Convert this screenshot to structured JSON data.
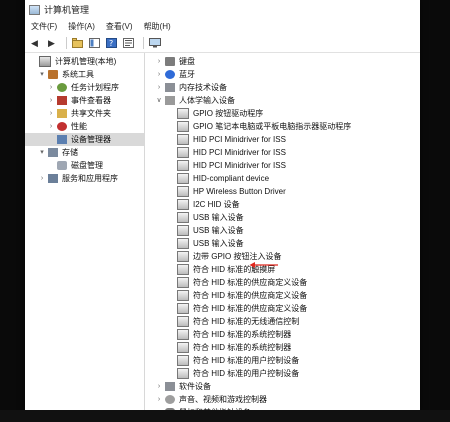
{
  "window": {
    "title": "计算机管理"
  },
  "menu": [
    "文件(F)",
    "操作(A)",
    "查看(V)",
    "帮助(H)"
  ],
  "left_tree": [
    {
      "label": "计算机管理(本地)",
      "indent": 0,
      "exp": "",
      "icon": "computer-management-icon",
      "cls": "ico-mgmt"
    },
    {
      "label": "系统工具",
      "indent": 1,
      "exp": "▾",
      "icon": "system-tools-icon",
      "cls": "ico-tools"
    },
    {
      "label": "任务计划程序",
      "indent": 2,
      "exp": "›",
      "icon": "task-scheduler-icon",
      "cls": "ico-task"
    },
    {
      "label": "事件查看器",
      "indent": 2,
      "exp": "›",
      "icon": "event-viewer-icon",
      "cls": "ico-event"
    },
    {
      "label": "共享文件夹",
      "indent": 2,
      "exp": "›",
      "icon": "shared-folders-icon",
      "cls": "ico-share"
    },
    {
      "label": "性能",
      "indent": 2,
      "exp": "›",
      "icon": "performance-icon",
      "cls": "ico-perf"
    },
    {
      "label": "设备管理器",
      "indent": 2,
      "exp": "",
      "icon": "device-manager-icon",
      "cls": "ico-dev",
      "selected": true
    },
    {
      "label": "存储",
      "indent": 1,
      "exp": "▾",
      "icon": "storage-icon",
      "cls": "ico-storage"
    },
    {
      "label": "磁盘管理",
      "indent": 2,
      "exp": "",
      "icon": "disk-management-icon",
      "cls": "ico-disk"
    },
    {
      "label": "服务和应用程序",
      "indent": 1,
      "exp": "›",
      "icon": "services-icon",
      "cls": "ico-svc"
    }
  ],
  "device_tree": [
    {
      "label": "键盘",
      "indent": 0,
      "exp": "›",
      "icon": "keyboard-icon",
      "cls": "ico-kbd"
    },
    {
      "label": "蓝牙",
      "indent": 0,
      "exp": "›",
      "icon": "bluetooth-icon",
      "cls": "ico-bt"
    },
    {
      "label": "内存技术设备",
      "indent": 0,
      "exp": "›",
      "icon": "memory-device-icon",
      "cls": "ico-fw"
    },
    {
      "label": "人体学输入设备",
      "indent": 0,
      "exp": "∨",
      "icon": "hid-category-icon",
      "cls": "ico-hid"
    },
    {
      "label": "GPIO 按钮驱动程序",
      "indent": 1,
      "exp": "",
      "icon": "hid-device-icon",
      "cls": "ico-hidev"
    },
    {
      "label": "GPIO 笔记本电脑或平板电脑指示器驱动程序",
      "indent": 1,
      "exp": "",
      "icon": "hid-device-icon",
      "cls": "ico-hidev"
    },
    {
      "label": "HID PCI Minidriver for ISS",
      "indent": 1,
      "exp": "",
      "icon": "hid-device-icon",
      "cls": "ico-hidev"
    },
    {
      "label": "HID PCI Minidriver for ISS",
      "indent": 1,
      "exp": "",
      "icon": "hid-device-icon",
      "cls": "ico-hidev"
    },
    {
      "label": "HID PCI Minidriver for ISS",
      "indent": 1,
      "exp": "",
      "icon": "hid-device-icon",
      "cls": "ico-hidev"
    },
    {
      "label": "HID-compliant device",
      "indent": 1,
      "exp": "",
      "icon": "hid-device-icon",
      "cls": "ico-hidev"
    },
    {
      "label": "HP Wireless Button Driver",
      "indent": 1,
      "exp": "",
      "icon": "hid-device-icon",
      "cls": "ico-hidev"
    },
    {
      "label": "I2C HID 设备",
      "indent": 1,
      "exp": "",
      "icon": "hid-device-icon",
      "cls": "ico-hidev"
    },
    {
      "label": "USB 输入设备",
      "indent": 1,
      "exp": "",
      "icon": "hid-device-icon",
      "cls": "ico-hidev"
    },
    {
      "label": "USB 输入设备",
      "indent": 1,
      "exp": "",
      "icon": "hid-device-icon",
      "cls": "ico-hidev"
    },
    {
      "label": "USB 输入设备",
      "indent": 1,
      "exp": "",
      "icon": "hid-device-icon",
      "cls": "ico-hidev"
    },
    {
      "label": "边带 GPIO 按钮注入设备",
      "indent": 1,
      "exp": "",
      "icon": "hid-device-icon",
      "cls": "ico-hidev"
    },
    {
      "label": "符合 HID 标准的触摸屏",
      "indent": 1,
      "exp": "",
      "icon": "hid-device-icon",
      "cls": "ico-hidev"
    },
    {
      "label": "符合 HID 标准的供应商定义设备",
      "indent": 1,
      "exp": "",
      "icon": "hid-device-icon",
      "cls": "ico-hidev"
    },
    {
      "label": "符合 HID 标准的供应商定义设备",
      "indent": 1,
      "exp": "",
      "icon": "hid-device-icon",
      "cls": "ico-hidev"
    },
    {
      "label": "符合 HID 标准的供应商定义设备",
      "indent": 1,
      "exp": "",
      "icon": "hid-device-icon",
      "cls": "ico-hidev"
    },
    {
      "label": "符合 HID 标准的无线通信控制",
      "indent": 1,
      "exp": "",
      "icon": "hid-device-icon",
      "cls": "ico-hidev"
    },
    {
      "label": "符合 HID 标准的系统控制器",
      "indent": 1,
      "exp": "",
      "icon": "hid-device-icon",
      "cls": "ico-hidev"
    },
    {
      "label": "符合 HID 标准的系统控制器",
      "indent": 1,
      "exp": "",
      "icon": "hid-device-icon",
      "cls": "ico-hidev"
    },
    {
      "label": "符合 HID 标准的用户控制设备",
      "indent": 1,
      "exp": "",
      "icon": "hid-device-icon",
      "cls": "ico-hidev"
    },
    {
      "label": "符合 HID 标准的用户控制设备",
      "indent": 1,
      "exp": "",
      "icon": "hid-device-icon",
      "cls": "ico-hidev"
    },
    {
      "label": "软件设备",
      "indent": 0,
      "exp": "›",
      "icon": "software-device-icon",
      "cls": "ico-fw"
    },
    {
      "label": "声音、视频和游戏控制器",
      "indent": 0,
      "exp": "›",
      "icon": "sound-icon",
      "cls": "ico-sound"
    },
    {
      "label": "鼠标和其他指针设备",
      "indent": 0,
      "exp": "›",
      "icon": "mouse-icon",
      "cls": "ico-mouse"
    }
  ],
  "annotation": {
    "color": "#e0281e"
  }
}
